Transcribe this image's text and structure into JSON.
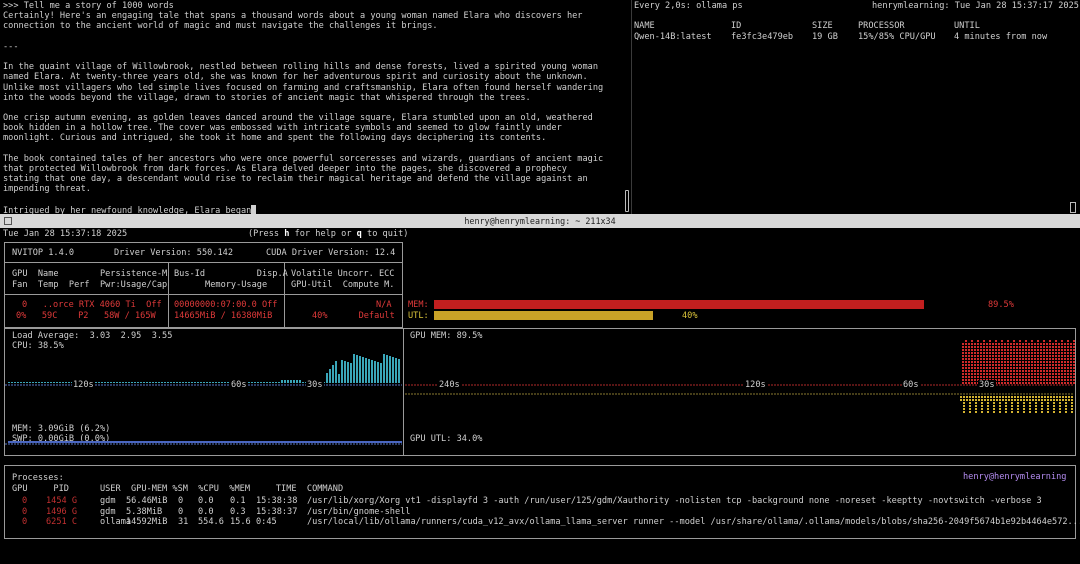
{
  "chat": {
    "lines": [
      ">>> Tell me a story of 1000 words",
      "Certainly! Here's an engaging tale that spans a thousand words about a young woman named Elara who discovers her",
      "connection to the ancient world of magic and must navigate the challenges it brings.",
      "",
      "---",
      "",
      "In the quaint village of Willowbrook, nestled between rolling hills and dense forests, lived a spirited young woman",
      "named Elara. At twenty-three years old, she was known for her adventurous spirit and curiosity about the unknown.",
      "Unlike most villagers who led simple lives focused on farming and craftsmanship, Elara often found herself wandering",
      "into the woods beyond the village, drawn to stories of ancient magic that whispered through the trees.",
      "",
      "One crisp autumn evening, as golden leaves danced around the village square, Elara stumbled upon an old, weathered",
      "book hidden in a hollow tree. The cover was embossed with intricate symbols and seemed to glow faintly under",
      "moonlight. Curious and intrigued, she took it home and spent the following days deciphering its contents.",
      "",
      "The book contained tales of her ancestors who were once powerful sorceresses and wizards, guardians of ancient magic",
      "that protected Willowbrook from dark forces. As Elara delved deeper into the pages, she discovered a prophecy",
      "stating that one day, a descendant would rise to reclaim their magical heritage and defend the village against an",
      "impending threat.",
      "",
      "Intrigued by her newfound knowledge, Elara began"
    ]
  },
  "ps": {
    "header_left": "Every 2,0s: ollama ps",
    "header_right": "henrymlearning: Tue Jan 28 15:37:17 2025",
    "columns": [
      "NAME",
      "ID",
      "SIZE",
      "PROCESSOR",
      "UNTIL"
    ],
    "row": [
      "Qwen-14B:latest",
      "fe3fc3e479eb",
      "19 GB",
      "15%/85% CPU/GPU",
      "4 minutes from now"
    ]
  },
  "window_title": "henry@henrymlearning: ~ 211x34",
  "nvitop": {
    "timestamp": "Tue Jan 28 15:37:18 2025",
    "help_pre": "(Press ",
    "help_h": "h",
    "help_mid": " for help or ",
    "help_q": "q",
    "help_post": " to quit)",
    "version": "NVITOP 1.4.0",
    "driver": "Driver Version: 550.142",
    "cuda": "CUDA Driver Version: 12.4",
    "hdr1": "GPU  Name        Persistence-M",
    "hdr2": "Fan  Temp  Perf  Pwr:Usage/Cap",
    "hdr3": "Bus-Id          Disp.A",
    "hdr4": "      Memory-Usage",
    "hdr5": "Volatile Uncorr. ECC",
    "hdr6": "GPU-Util  Compute M.",
    "gpu1": "0   ..orce RTX 4060 Ti  Off",
    "gpu2": "0%   59C    P2   58W / 165W",
    "gpu3": "00000000:07:00.0 Off",
    "gpu4": "14665MiB / 16380MiB",
    "gpu5": "N/A",
    "gpu6": "40%      Default",
    "mem_label": "MEM:",
    "mem_value": "89.5%",
    "mem_fraction": 0.895,
    "utl_label": "UTL:",
    "utl_value": "40%",
    "utl_fraction": 0.4,
    "load_avg": "Load Average:  3.03  2.95  3.55",
    "cpu": "CPU: 38.5%",
    "mem": "MEM: 3.09GiB (6.2%)",
    "swp": "SWP: 0.00GiB (0.0%)",
    "gpu_mem": "GPU MEM: 89.5%",
    "gpu_utl": "GPU UTL: 34.0%",
    "cpu_ticks": [
      "120s",
      "60s",
      "30s"
    ],
    "gpu_ticks": [
      "240s",
      "120s",
      "60s",
      "30s"
    ],
    "processes_label": "Processes:",
    "user_host": "henry@henrymlearning",
    "proc_header": "GPU     PID      USER  GPU-MEM %SM  %CPU  %MEM     TIME  COMMAND",
    "processes": [
      {
        "gpu": "0",
        "pid": "1454 G",
        "user": "gdm",
        "gpumem": "56.46MiB",
        "sm": "0",
        "cpu": "0.0",
        "mem": "0.1",
        "time": "15:38:38",
        "command": "/usr/lib/xorg/Xorg vt1 -displayfd 3 -auth /run/user/125/gdm/Xauthority -nolisten tcp -background none -noreset -keeptty -novtswitch -verbose 3"
      },
      {
        "gpu": "0",
        "pid": "1496 G",
        "user": "gdm",
        "gpumem": "5.38MiB",
        "sm": "0",
        "cpu": "0.0",
        "mem": "0.3",
        "time": "15:38:37",
        "command": "/usr/bin/gnome-shell"
      },
      {
        "gpu": "0",
        "pid": "6251 C",
        "user": "ollama",
        "gpumem": "14592MiB",
        "sm": "31",
        "cpu": "554.6",
        "mem": "15.6",
        "time": "0:45",
        "command": "/usr/local/lib/ollama/runners/cuda_v12_avx/ollama_llama_server runner --model /usr/share/ollama/.ollama/models/blobs/sha256-2049f5674b1e92b4464e572..."
      }
    ]
  },
  "colors": {
    "background": "#000000",
    "text": "#d0d0d0",
    "red": "#e03a3a",
    "mem_bar": "#c21f1f",
    "utl_bar": "#c9a227",
    "cpu_graph": "#3aa6b9",
    "titlebar": "#d8d8d8"
  }
}
